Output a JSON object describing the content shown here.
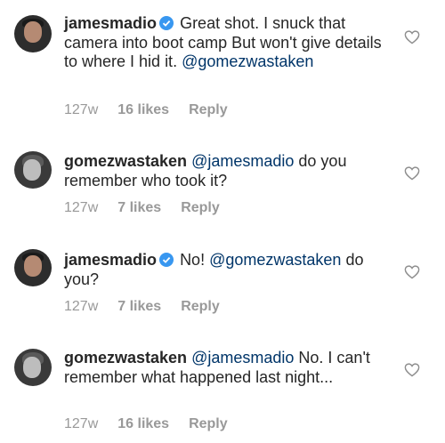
{
  "comments": [
    {
      "username": "jamesmadio",
      "verified": true,
      "text": "Great shot. I snuck that camera into boot camp But won't give details to where I hid it.",
      "mention": "@gomezwastaken",
      "mention_position": "end",
      "time": "127w",
      "likes": "16 likes",
      "reply": "Reply"
    },
    {
      "username": "gomezwastaken",
      "verified": false,
      "mention": "@jamesmadio",
      "mention_position": "start",
      "text": "do you remember who took it?",
      "time": "127w",
      "likes": "7 likes",
      "reply": "Reply"
    },
    {
      "username": "jamesmadio",
      "verified": true,
      "text_before": "No!",
      "mention": "@gomezwastaken",
      "text": "do you?",
      "time": "127w",
      "likes": "7 likes",
      "reply": "Reply"
    },
    {
      "username": "gomezwastaken",
      "verified": false,
      "mention": "@jamesmadio",
      "mention_position": "start",
      "text": "No. I can't remember what happened last night...",
      "time": "127w",
      "likes": "16 likes",
      "reply": "Reply"
    }
  ],
  "icons": {
    "verified": "verified-badge-icon",
    "like": "heart-icon"
  },
  "colors": {
    "mention": "#003569",
    "meta": "#999999",
    "verified": "#3897f0"
  }
}
